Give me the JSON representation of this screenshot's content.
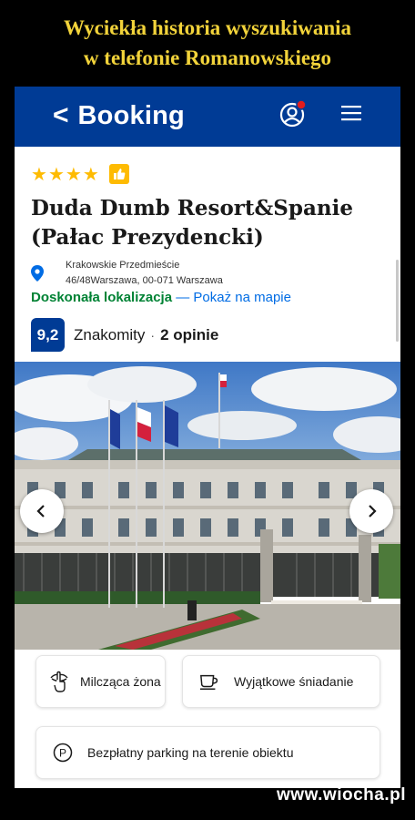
{
  "meme": {
    "title_line1": "Wyciekła historia wyszukiwania",
    "title_line2": "w telefonie Romanowskiego",
    "watermark": "www.wiocha.pl"
  },
  "header": {
    "back_icon": "chevron-left-icon",
    "brand": "Booking",
    "profile_icon": "user-notification-icon",
    "menu_icon": "hamburger-menu-icon",
    "background": "#003b95"
  },
  "hotel": {
    "stars": [
      "★",
      "★",
      "★",
      "★"
    ],
    "star_count": 4,
    "thumb_icon": "thumbs-up-icon",
    "name_line1": "Duda Dumb Resort&Spanie",
    "name_line2": "(Pałac Prezydencki)",
    "address_line1": "Krakowskie Przedmieście",
    "address_line2": "46/48Warszawa, 00-071 Warszawa",
    "location_rating": "Doskonała lokalizacja",
    "location_dash": "—",
    "map_link": "Pokaż na mapie",
    "score": "9,2",
    "score_label": "Znakomity",
    "score_dot": "·",
    "reviews": "2 opinie"
  },
  "gallery": {
    "prev_icon": "chevron-left-icon",
    "next_icon": "chevron-right-icon"
  },
  "facilities": [
    {
      "icon": "finger-on-lips-icon",
      "label": "Milcząca żona"
    },
    {
      "icon": "coffee-cup-icon",
      "label": "Wyjątkowe śniadanie"
    },
    {
      "icon": "parking-icon",
      "label": "Bezpłatny parking na terenie obiektu"
    }
  ],
  "colors": {
    "brand_blue": "#003b95",
    "link_blue": "#006ce4",
    "star_yellow": "#febb02",
    "location_green": "#008234",
    "title_yellow": "#f2d33a"
  }
}
